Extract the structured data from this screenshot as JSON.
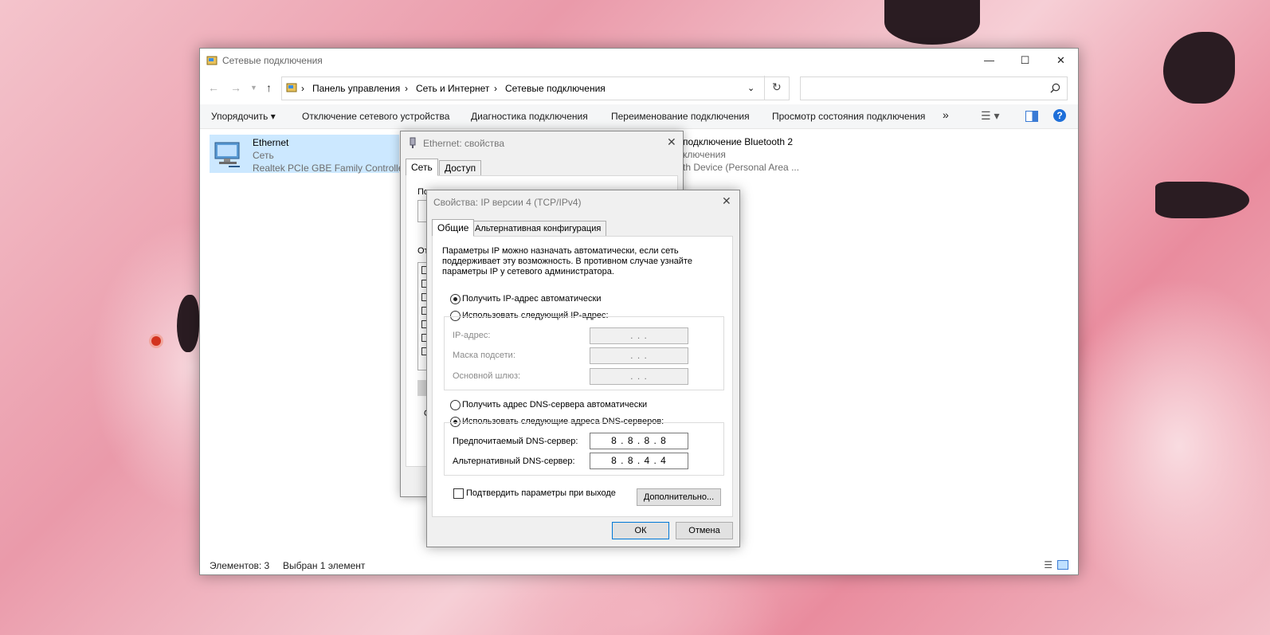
{
  "explorer": {
    "title": "Сетевые подключения",
    "breadcrumb": [
      "Панель управления",
      "Сеть и Интернет",
      "Сетевые подключения"
    ],
    "toolbar": {
      "organize": "Упорядочить",
      "disable": "Отключение сетевого устройства",
      "diagnose": "Диагностика подключения",
      "rename": "Переименование подключения",
      "status": "Просмотр состояния подключения",
      "more": "»"
    },
    "items": [
      {
        "name": "Ethernet",
        "type": "Сеть",
        "device": "Realtek PCIe GBE Family Controller"
      },
      {
        "name": "подключение Bluetooth 2",
        "type": "ключения",
        "device": "th Device (Personal Area ..."
      }
    ],
    "statusbar": {
      "count": "Элементов: 3",
      "selected": "Выбран 1 элемент"
    }
  },
  "eth_dialog": {
    "title": "Ethernet: свойства",
    "tabs": [
      "Сеть",
      "Доступ"
    ],
    "partial_labels": [
      "По",
      "От",
      "О"
    ]
  },
  "ipv4_dialog": {
    "title": "Свойства: IP версии 4 (TCP/IPv4)",
    "tabs": [
      "Общие",
      "Альтернативная конфигурация"
    ],
    "intro": [
      "Параметры IP можно назначать автоматически, если сеть",
      "поддерживает эту возможность. В противном случае узнайте",
      "параметры IP у сетевого администратора."
    ],
    "auto_ip": "Получить IP-адрес автоматически",
    "manual_ip": "Использовать следующий IP-адрес:",
    "ip_label": "IP-адрес:",
    "mask_label": "Маска подсети:",
    "gateway_label": "Основной шлюз:",
    "empty_ip": ".    .    .",
    "auto_dns": "Получить адрес DNS-сервера автоматически",
    "manual_dns": "Использовать следующие адреса DNS-серверов:",
    "preferred_label": "Предпочитаемый DNS-сервер:",
    "preferred_value": "8 . 8 . 8 . 8",
    "alternate_label": "Альтернативный DNS-сервер:",
    "alternate_value": "8 . 8 . 4 . 4",
    "validate": "Подтвердить параметры при выходе",
    "advanced": "Дополнительно...",
    "ok": "ОК",
    "cancel": "Отмена"
  },
  "colors": {
    "accent": "#0078d7",
    "selection": "#cce8ff"
  }
}
